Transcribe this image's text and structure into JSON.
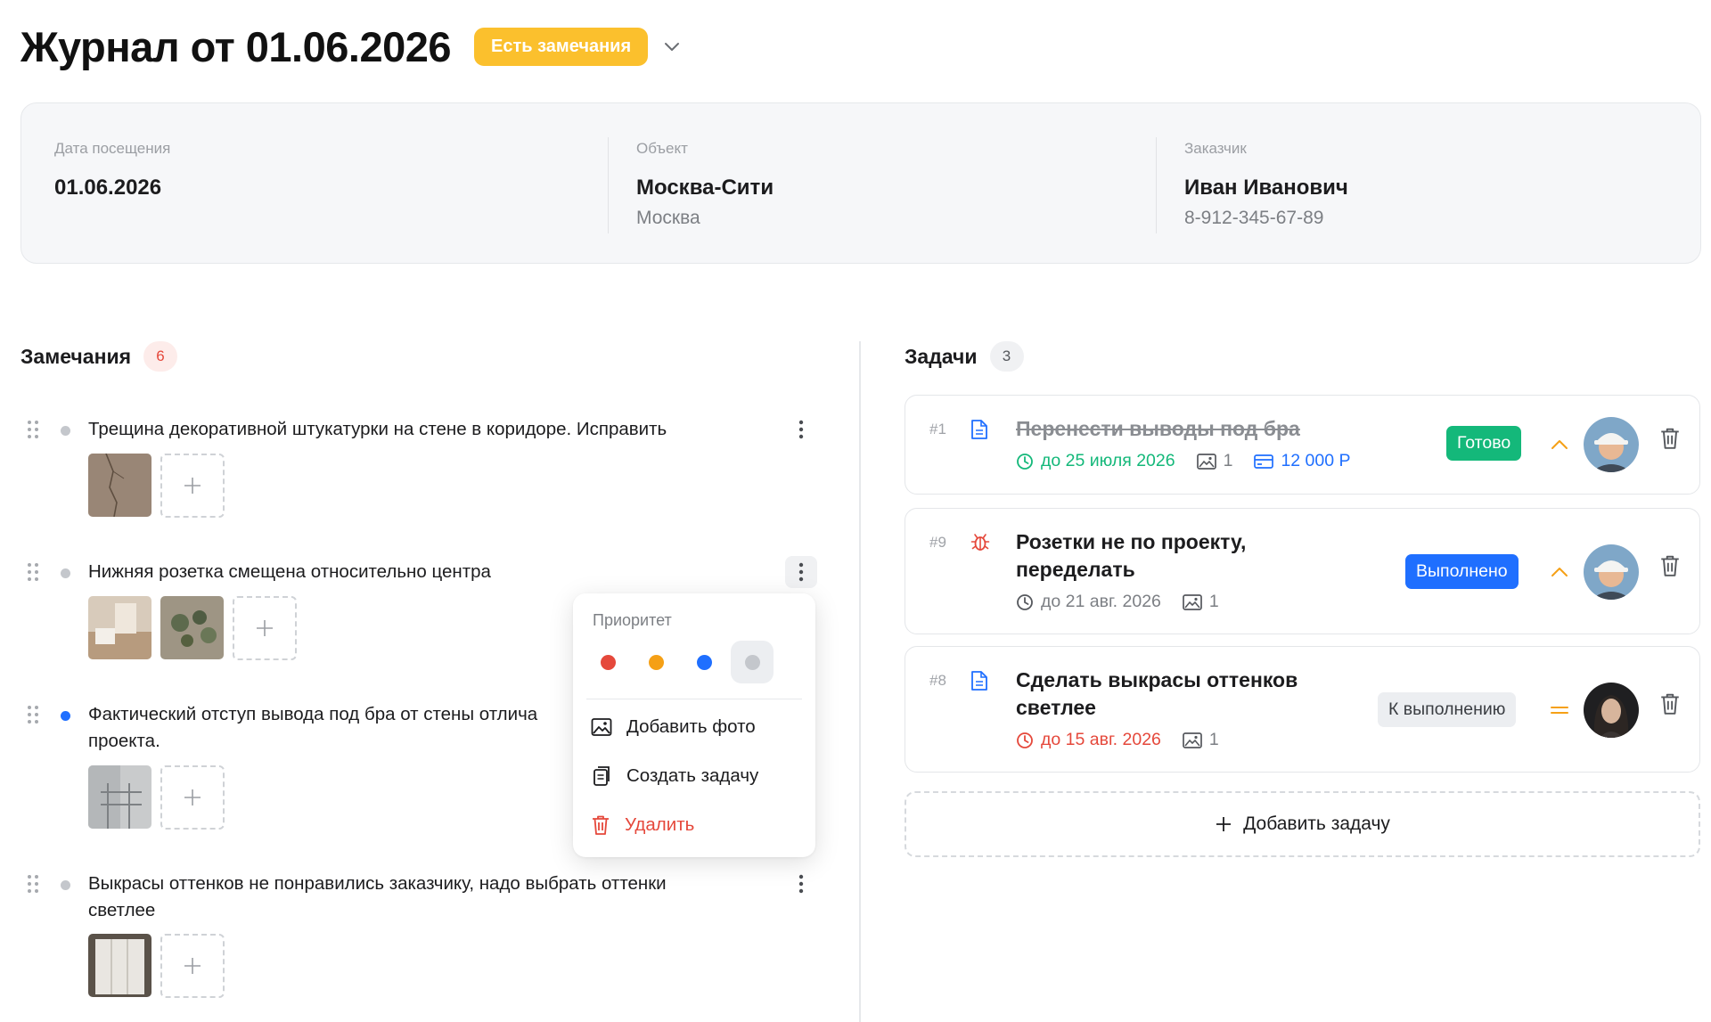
{
  "header": {
    "title": "Журнал от 01.06.2026",
    "status": "Есть замечания",
    "status_color": "#fbc02d"
  },
  "info": {
    "visit_label": "Дата посещения",
    "visit_value": "01.06.2026",
    "object_label": "Объект",
    "object_value": "Москва-Сити",
    "object_sub": "Москва",
    "customer_label": "Заказчик",
    "customer_value": "Иван Иванович",
    "customer_phone": "8-912-345-67-89"
  },
  "remarks": {
    "title": "Замечания",
    "count": "6",
    "items": [
      {
        "text": "Трещина декоративной штукатурки на стене в коридоре. Исправить",
        "priority_color": "#c4c7cc",
        "photos": 1
      },
      {
        "text": "Нижняя розетка смещена относительно центра",
        "priority_color": "#c4c7cc",
        "photos": 2
      },
      {
        "text": "Фактический отступ вывода под бра от стены отлича",
        "text_line2": "проекта.",
        "priority_color": "#1f6fff",
        "photos": 1
      },
      {
        "text": "Выкрасы оттенков не понравились заказчику, надо выбрать оттенки",
        "text_line2": "светлее",
        "priority_color": "#c4c7cc",
        "photos": 1
      }
    ]
  },
  "context_menu": {
    "priority_label": "Приоритет",
    "priority_colors": [
      "#e5483b",
      "#f5a016",
      "#1f6fff",
      "#c4c7cc"
    ],
    "add_photo": "Добавить фото",
    "create_task": "Создать задачу",
    "delete": "Удалить"
  },
  "tasks": {
    "title": "Задачи",
    "count": "3",
    "items": [
      {
        "num": "#1",
        "title": "Перенести выводы под бра",
        "due": "до 25 июля 2026",
        "photos": "1",
        "price": "12 000 Р",
        "status": "Готово",
        "status_bg": "#14b87a",
        "status_fg": "#ffffff",
        "done": true,
        "type_icon": "document-icon"
      },
      {
        "num": "#9",
        "title_line1": "Розетки не по проекту,",
        "title_line2": "переделать",
        "due": "до 21 авг. 2026",
        "photos": "1",
        "status": "Выполнено",
        "status_bg": "#1f6fff",
        "status_fg": "#ffffff",
        "type_icon": "bug-icon"
      },
      {
        "num": "#8",
        "title_line1": "Сделать выкрасы оттенков",
        "title_line2": "светлее",
        "due": "до 15 авг. 2026",
        "photos": "1",
        "status": "К выполнению",
        "status_bg": "#eceef1",
        "status_fg": "#3a3d42",
        "type_icon": "document-icon"
      }
    ],
    "add_task": "Добавить задачу"
  }
}
